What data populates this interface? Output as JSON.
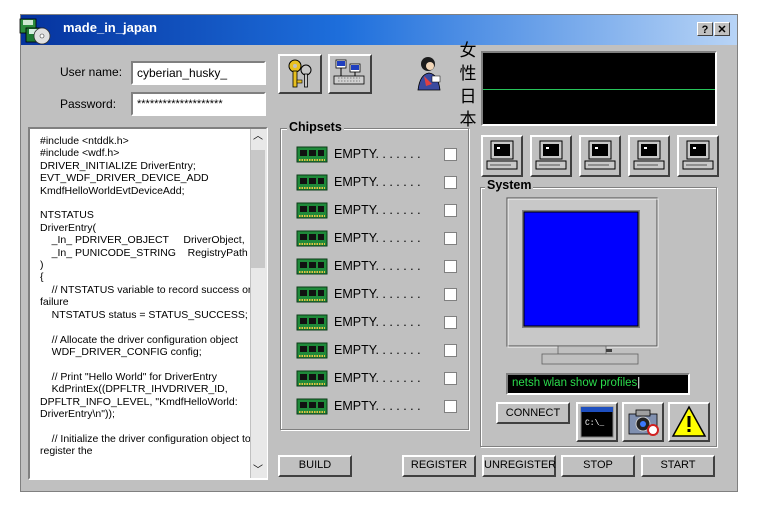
{
  "window": {
    "title": "made_in_japan",
    "help_btn": "?",
    "close_btn": "✕"
  },
  "login": {
    "username_label": "User name:",
    "username_value": "cyberian_husky_",
    "password_label": "Password:",
    "password_value": "********************"
  },
  "code_text": "#include <ntddk.h>\n#include <wdf.h>\nDRIVER_INITIALIZE DriverEntry;\nEVT_WDF_DRIVER_DEVICE_ADD\nKmdfHelloWorldEvtDeviceAdd;\n\nNTSTATUS\nDriverEntry(\n    _In_ PDRIVER_OBJECT     DriverObject,\n    _In_ PUNICODE_STRING    RegistryPath\n)\n{\n    // NTSTATUS variable to record success or failure\n    NTSTATUS status = STATUS_SUCCESS;\n\n    // Allocate the driver configuration object\n    WDF_DRIVER_CONFIG config;\n\n    // Print \"Hello World\" for DriverEntry\n    KdPrintEx((DPFLTR_IHVDRIVER_ID, DPFLTR_INFO_LEVEL, \"KmdfHelloWorld: DriverEntry\\n\"));\n\n    // Initialize the driver configuration object to register the",
  "japanese": [
    "女",
    "性",
    "日",
    "本"
  ],
  "chipsets": {
    "title": "Chipsets",
    "items": [
      {
        "label": "EMPTY. . . . . . ."
      },
      {
        "label": "EMPTY. . . . . . ."
      },
      {
        "label": "EMPTY. . . . . . ."
      },
      {
        "label": "EMPTY. . . . . . ."
      },
      {
        "label": "EMPTY. . . . . . ."
      },
      {
        "label": "EMPTY. . . . . . ."
      },
      {
        "label": "EMPTY. . . . . . ."
      },
      {
        "label": "EMPTY. . . . . . ."
      },
      {
        "label": "EMPTY. . . . . . ."
      },
      {
        "label": "EMPTY. . . . . . ."
      }
    ]
  },
  "system": {
    "title": "System",
    "command_value": "netsh wlan show profiles",
    "connect_label": "CONNECT",
    "screen_color": "#0000ff",
    "terminal_prompt": "C:\\_"
  },
  "buttons": {
    "build": "BUILD",
    "register": "REGISTER",
    "unregister": "UNREGISTER",
    "stop": "STOP",
    "start": "START"
  },
  "colors": {
    "title_start": "#05339e",
    "monitor_line": "#27c45a",
    "command_text": "#2bdc4c"
  }
}
